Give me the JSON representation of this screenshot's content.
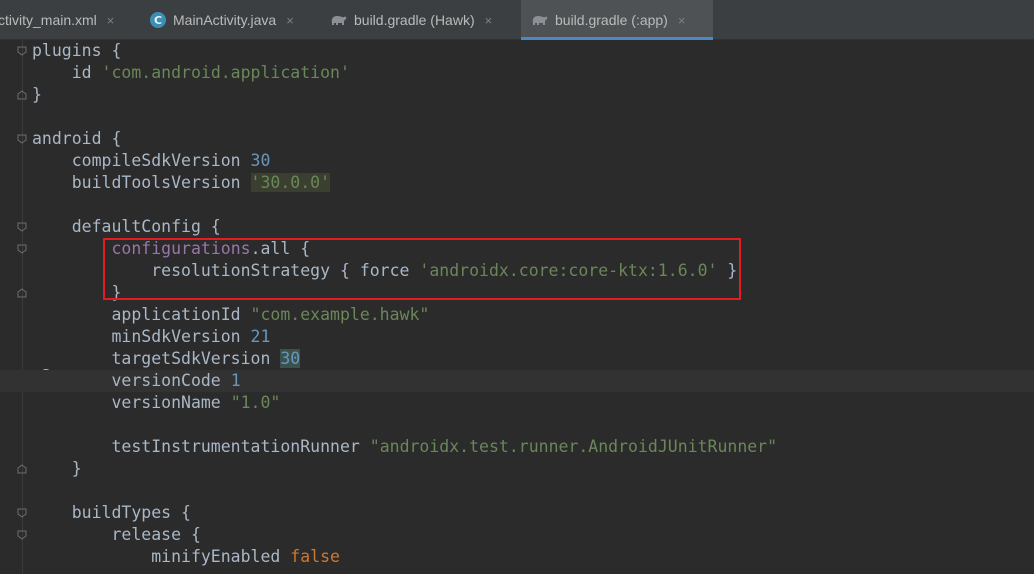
{
  "tabs": [
    {
      "label": "ctivity_main.xml",
      "icon": "none",
      "active": false
    },
    {
      "label": "MainActivity.java",
      "icon": "java-class-icon",
      "active": false
    },
    {
      "label": "build.gradle (Hawk)",
      "icon": "gradle-elephant-icon",
      "active": false
    },
    {
      "label": "build.gradle (:app)",
      "icon": "gradle-elephant-icon",
      "active": true
    }
  ],
  "icons": {
    "close": "×",
    "java_letter": "C"
  },
  "colors": {
    "background": "#2b2b2b",
    "tab_bar": "#3c3f41",
    "active_tab_underline": "#4a88c7",
    "string": "#6a8759",
    "number": "#6897bb",
    "keyword": "#cc7832",
    "property": "#9876aa",
    "annotation_box": "#e31c23"
  },
  "code": {
    "l1": {
      "a": "plugins {"
    },
    "l2": {
      "a": "    id ",
      "s": "'com.android.application'"
    },
    "l3": {
      "a": "}"
    },
    "l4": {
      "a": ""
    },
    "l5": {
      "a": "android {"
    },
    "l6": {
      "a": "    compileSdkVersion ",
      "n": "30"
    },
    "l7": {
      "a": "    buildToolsVersion ",
      "s": "'30.0.0'"
    },
    "l8": {
      "a": ""
    },
    "l9": {
      "a": "    defaultConfig {"
    },
    "l10": {
      "a": "        ",
      "p": "configurations",
      "b": ".all {"
    },
    "l11": {
      "a": "            resolutionStrategy { force ",
      "s": "'androidx.core:core-ktx:1.6.0'",
      "b": " }"
    },
    "l12": {
      "a": "        }"
    },
    "l13": {
      "a": "        applicationId ",
      "s": "\"com.example.hawk\""
    },
    "l14": {
      "a": "        minSdkVersion ",
      "n": "21"
    },
    "l15": {
      "a": "        targetSdkVersion ",
      "n": "30"
    },
    "l16": {
      "a": "        versionCode ",
      "n": "1"
    },
    "l17": {
      "a": "        versionName ",
      "s": "\"1.0\""
    },
    "l18": {
      "a": ""
    },
    "l19": {
      "a": "        testInstrumentationRunner ",
      "s": "\"androidx.test.runner.AndroidJUnitRunner\""
    },
    "l20": {
      "a": "    }"
    },
    "l21": {
      "a": ""
    },
    "l22": {
      "a": "    buildTypes {"
    },
    "l23": {
      "a": "        release {"
    },
    "l24": {
      "a": "            minifyEnabled ",
      "k": "false"
    }
  }
}
